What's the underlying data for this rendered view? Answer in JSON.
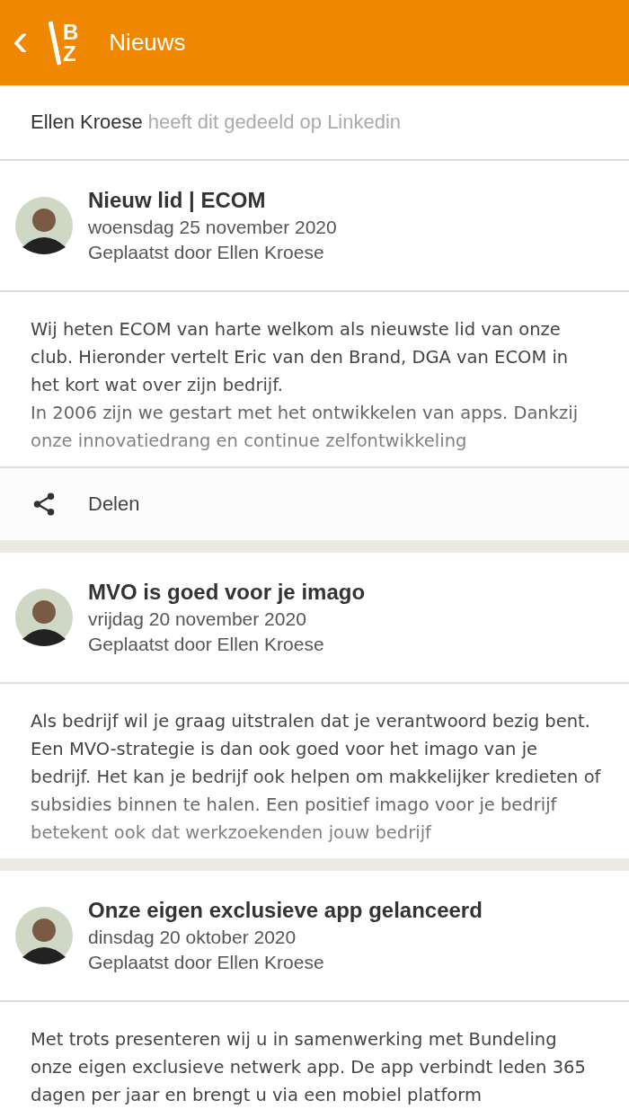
{
  "app_bar": {
    "back_icon": "‹",
    "logo_letters": [
      "B",
      "Z"
    ],
    "title": "Nieuws"
  },
  "shared_by": {
    "name": "Ellen Kroese",
    "text": "heeft dit gedeeld op Linkedin"
  },
  "posts": [
    {
      "title": "Nieuw lid | ECOM",
      "date": "woensdag 25 november 2020",
      "author": "Geplaatst door Ellen Kroese",
      "faded": true,
      "paragraphs": [
        "Wij heten ECOM van harte welkom als nieuwste lid van onze club. Hieronder vertelt Eric van den Brand, DGA van ECOM in het kort wat over zijn bedrijf.",
        "In 2006 zijn we gestart met het ontwikkelen van apps. Dankzij onze innovatiedrang en continue zelfontwikkeling"
      ],
      "share": {
        "label": "Delen"
      }
    },
    {
      "title": "MVO is goed voor je imago",
      "date": "vrijdag 20 november 2020",
      "author": "Geplaatst door Ellen Kroese",
      "faded": true,
      "paragraphs": [
        "Als bedrijf wil je graag uitstralen dat je verantwoord bezig bent. Een MVO-strategie is dan ook goed voor het imago van je bedrijf. Het kan je bedrijf ook helpen om makkelijker kredieten of subsidies binnen te halen. Een positief imago voor je bedrijf betekent ook dat werkzoekenden jouw bedrijf"
      ]
    },
    {
      "title": "Onze eigen exclusieve app gelanceerd",
      "date": "dinsdag 20 oktober 2020",
      "author": "Geplaatst door Ellen Kroese",
      "faded": false,
      "paragraphs": [
        "Met trots presenteren wij u in samenwerking met Bundeling onze eigen exclusieve netwerk app. De app verbindt leden 365 dagen per jaar en brengt u via een mobiel platform"
      ]
    }
  ]
}
